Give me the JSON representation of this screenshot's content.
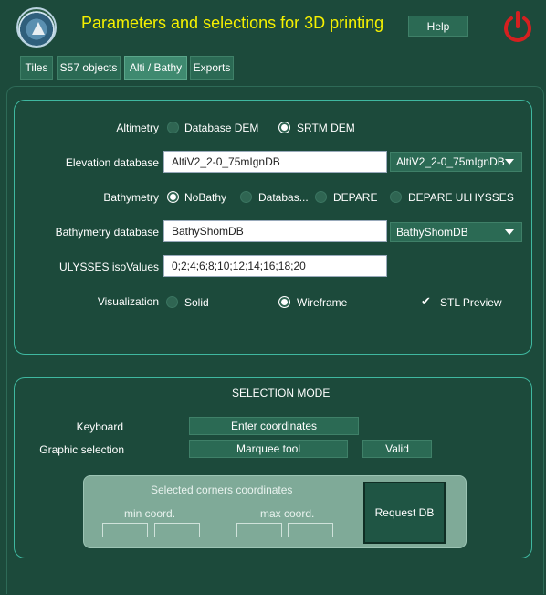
{
  "header": {
    "title": "Parameters and selections for 3D printing",
    "help_label": "Help",
    "power_icon": "power-icon",
    "logo_icon": "logo-icon"
  },
  "tabs": [
    {
      "label": "Tiles"
    },
    {
      "label": "S57 objects"
    },
    {
      "label": "Alti / Bathy",
      "active": true
    },
    {
      "label": "Exports"
    }
  ],
  "params": {
    "altimetry_label": "Altimetry",
    "altimetry_options": [
      "Database DEM",
      "SRTM DEM"
    ],
    "altimetry_selected": "SRTM DEM",
    "elevation_label": "Elevation database",
    "elevation_value": "AltiV2_2-0_75mIgnDB",
    "elevation_select": "AltiV2_2-0_75mIgnDB",
    "bathymetry_label": "Bathymetry",
    "bathymetry_options": [
      "NoBathy",
      "Databas...",
      "DEPARE",
      "DEPARE ULHYSSES"
    ],
    "bathymetry_selected": "NoBathy",
    "bathy_db_label": "Bathymetry database",
    "bathy_db_value": "BathyShomDB",
    "bathy_db_select": "BathyShomDB",
    "ulysses_label": "ULYSSES isoValues",
    "ulysses_value": "0;2;4;6;8;10;12;14;16;18;20",
    "visualization_label": "Visualization",
    "visualization_options": [
      "Solid",
      "Wireframe"
    ],
    "visualization_selected": "Wireframe",
    "stl_preview_label": "STL Preview",
    "stl_preview_checked": true
  },
  "selection": {
    "title": "SELECTION MODE",
    "keyboard_label": "Keyboard",
    "enter_coords_label": "Enter coordinates",
    "graphic_label": "Graphic selection",
    "marquee_label": "Marquee tool",
    "valid_label": "Valid",
    "corners_title": "Selected corners coordinates",
    "min_label": "min coord.",
    "max_label": "max coord.",
    "request_label": "Request DB"
  },
  "colors": {
    "background": "#1c4a3b",
    "title": "#f5f000",
    "accent_border": "#3fb8a0",
    "power": "#d42020"
  }
}
